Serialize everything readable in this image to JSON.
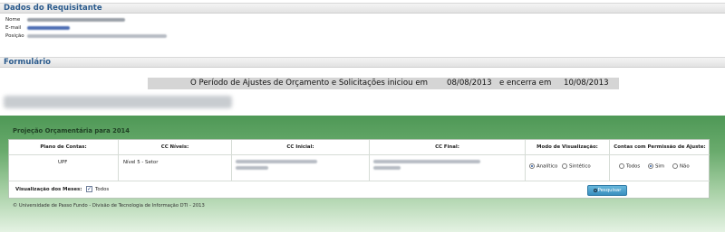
{
  "requisitante": {
    "section_title": "Dados do Requisitante",
    "nome_label": "Nome",
    "email_label": "E-mail",
    "posicao_label": "Posição"
  },
  "formulario": {
    "section_title": "Formulário"
  },
  "period": {
    "prefix": "O Período de Ajustes de Orçamento e Solicitações iniciou em",
    "start_date": "08/08/2013",
    "middle": "e encerra em",
    "end_date": "10/08/2013"
  },
  "panel": {
    "title": "Projeção Orçamentária para 2014",
    "headers": {
      "plano": "Plano de Contas:",
      "niveis": "CC Níveis:",
      "inicial": "CC Inicial:",
      "final": "CC Final:",
      "modo": "Modo de Visualização:",
      "contas": "Contas com Permissão de Ajuste:"
    },
    "values": {
      "plano": "UPF",
      "niveis": "Nível 5 - Setor"
    },
    "modo_options": {
      "analitico": "Analítico",
      "sintetico": "Sintético"
    },
    "contas_options": {
      "todos": "Todos",
      "sim": "Sim",
      "nao": "Não"
    },
    "meses_label": "Visualização dos Meses:",
    "meses_todos": "Todos",
    "search_label": "Pesquisar"
  },
  "footer": {
    "text": "© Universidade de Passo Fundo - Divisão de Tecnologia de Informação DTI - 2013"
  },
  "colors": {
    "accent_blue": "#2a5a8c",
    "panel_green": "#4e9856",
    "button_blue": "#3a8fbf"
  },
  "icons": {
    "search": "search-icon",
    "checkbox": "checkbox-checked-icon"
  },
  "state": {
    "modo_selected": "analitico",
    "contas_selected": "sim",
    "meses_todos_checked": true
  }
}
